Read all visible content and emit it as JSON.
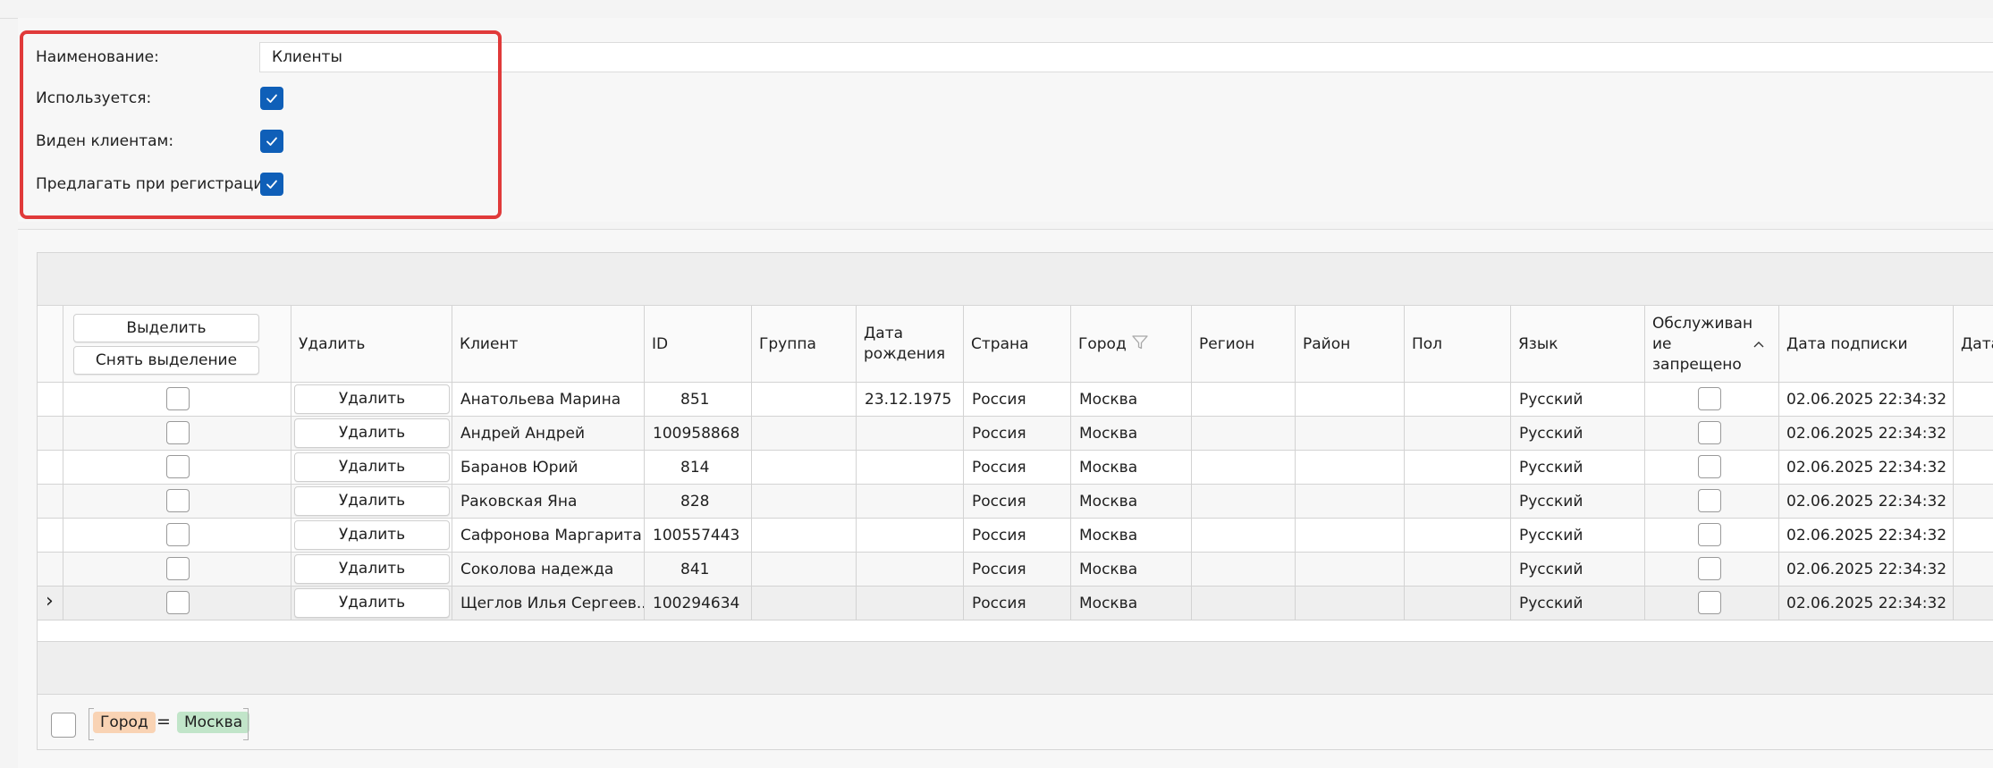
{
  "form": {
    "name_label": "Наименование:",
    "name_value": "Клиенты",
    "used_label": "Используется:",
    "visible_label": "Виден клиентам:",
    "offer_label": "Предлагать при регистрации:",
    "used_checked": true,
    "visible_checked": true,
    "offer_checked": true
  },
  "grid": {
    "select_button": "Выделить",
    "deselect_button": "Снять выделение",
    "columns": {
      "delete": "Удалить",
      "client": "Клиент",
      "id": "ID",
      "group": "Группа",
      "birth_line1": "Дата",
      "birth_line2": "рождения",
      "country": "Страна",
      "city": "Город",
      "region": "Регион",
      "district": "Район",
      "gender": "Пол",
      "language": "Язык",
      "banned_line1": "Обслуживан",
      "banned_line2": "ие",
      "banned_line3": "запрещено",
      "subscription_date": "Дата подписки",
      "next_cut": "Дата"
    },
    "row_delete_label": "Удалить",
    "rows": [
      {
        "client": "Анатольева Марина",
        "id": "851",
        "group": "",
        "birth": "23.12.1975",
        "country": "Россия",
        "city": "Москва",
        "region": "",
        "district": "",
        "gender": "",
        "language": "Русский",
        "subscription_date": "02.06.2025 22:34:32"
      },
      {
        "client": "Андрей Андрей",
        "id": "100958868",
        "group": "",
        "birth": "",
        "country": "Россия",
        "city": "Москва",
        "region": "",
        "district": "",
        "gender": "",
        "language": "Русский",
        "subscription_date": "02.06.2025 22:34:32"
      },
      {
        "client": "Баранов Юрий",
        "id": "814",
        "group": "",
        "birth": "",
        "country": "Россия",
        "city": "Москва",
        "region": "",
        "district": "",
        "gender": "",
        "language": "Русский",
        "subscription_date": "02.06.2025 22:34:32"
      },
      {
        "client": "Раковская Яна",
        "id": "828",
        "group": "",
        "birth": "",
        "country": "Россия",
        "city": "Москва",
        "region": "",
        "district": "",
        "gender": "",
        "language": "Русский",
        "subscription_date": "02.06.2025 22:34:32"
      },
      {
        "client": "Сафронова Маргарита",
        "id": "100557443",
        "group": "",
        "birth": "",
        "country": "Россия",
        "city": "Москва",
        "region": "",
        "district": "",
        "gender": "",
        "language": "Русский",
        "subscription_date": "02.06.2025 22:34:32"
      },
      {
        "client": "Соколова надежда",
        "id": "841",
        "group": "",
        "birth": "",
        "country": "Россия",
        "city": "Москва",
        "region": "",
        "district": "",
        "gender": "",
        "language": "Русский",
        "subscription_date": "02.06.2025 22:34:32"
      },
      {
        "client": "Щеглов Илья Сергеев...",
        "id": "100294634",
        "group": "",
        "birth": "",
        "country": "Россия",
        "city": "Москва",
        "region": "",
        "district": "",
        "gender": "",
        "language": "Русский",
        "subscription_date": "02.06.2025 22:34:32"
      }
    ],
    "current_row_marker": "›"
  },
  "filter": {
    "field": "Город",
    "operator": "=",
    "value": "Москва"
  },
  "colors": {
    "highlight_border": "#e03a3a",
    "checkbox_checked": "#0f5fb8",
    "filter_field_bg": "#f9d3b4",
    "filter_value_bg": "#c1e5c9"
  }
}
